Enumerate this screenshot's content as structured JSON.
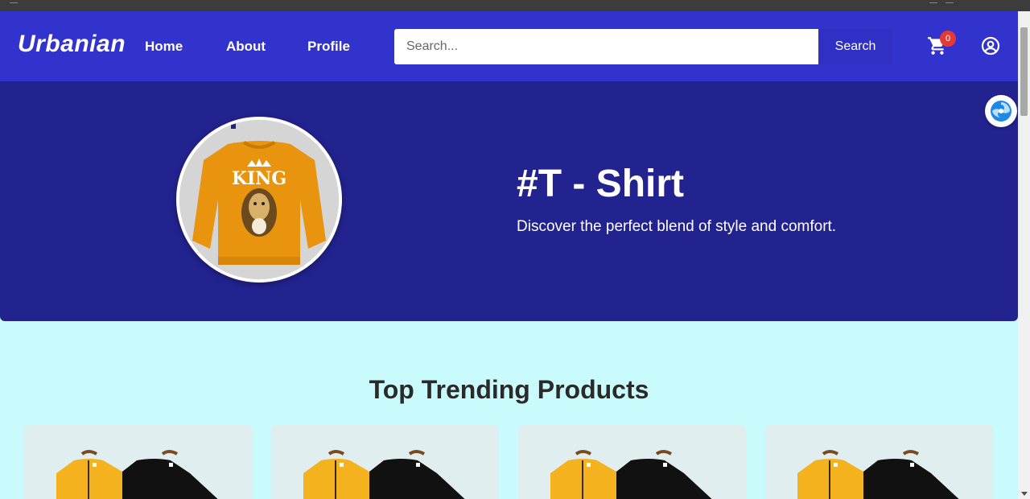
{
  "app": {
    "logo": "Urbanian"
  },
  "nav": {
    "links": [
      {
        "label": "Home"
      },
      {
        "label": "About"
      },
      {
        "label": "Profile"
      }
    ]
  },
  "search": {
    "placeholder": "Search...",
    "button_label": "Search"
  },
  "cart": {
    "count": "0",
    "icon": "cart-icon"
  },
  "account": {
    "icon": "account-circle-icon"
  },
  "hero": {
    "title": "#T - Shirt",
    "subtitle": "Discover the perfect blend of style and comfort.",
    "image_text": "KING"
  },
  "section": {
    "title": "Top Trending Products"
  },
  "products": [
    {
      "id": 1
    },
    {
      "id": 2
    },
    {
      "id": 3
    },
    {
      "id": 4
    }
  ],
  "colors": {
    "navbar": "#3232cc",
    "hero": "#22238f",
    "page_bg": "#c9fbfd",
    "badge": "#e53935"
  }
}
